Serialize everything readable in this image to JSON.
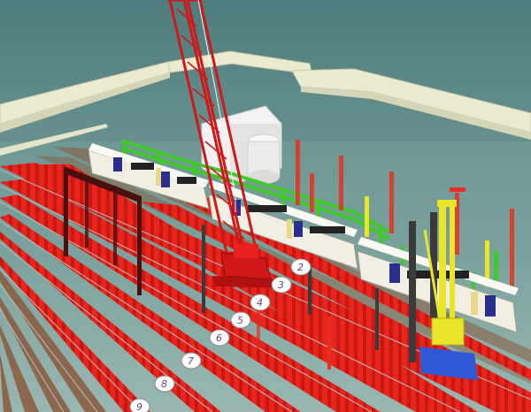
{
  "colors": {
    "sky_top": "#4f7f7f",
    "sky_bottom": "#9fbcb6",
    "platform_wall": "#ebebd0",
    "track_red": "#e8251c",
    "track_brown": "#8a5a3c",
    "rail_grey": "#b8b8b8",
    "tower_crane": "#d01818",
    "train_body": "#f1efe3",
    "train_door": "#2a2e8c",
    "train_window": "#222222",
    "green_fence": "#3ecb2a",
    "pile_rig": "#e9e62a",
    "pile_rig_base": "#2f58d6",
    "building": "#f2f2f2",
    "portal": "#4a1010",
    "label_text": "#6a3f7f"
  },
  "track_labels": [
    "2",
    "3",
    "4",
    "5",
    "6",
    "7",
    "8",
    "9"
  ],
  "objects": {
    "crane": "lattice-crawler-crane",
    "rig": "piling-rig",
    "train": "passenger-train",
    "building": "station-building",
    "portal": "gantry-portal",
    "platform": "platform-wall",
    "fence": "safety-fence"
  }
}
